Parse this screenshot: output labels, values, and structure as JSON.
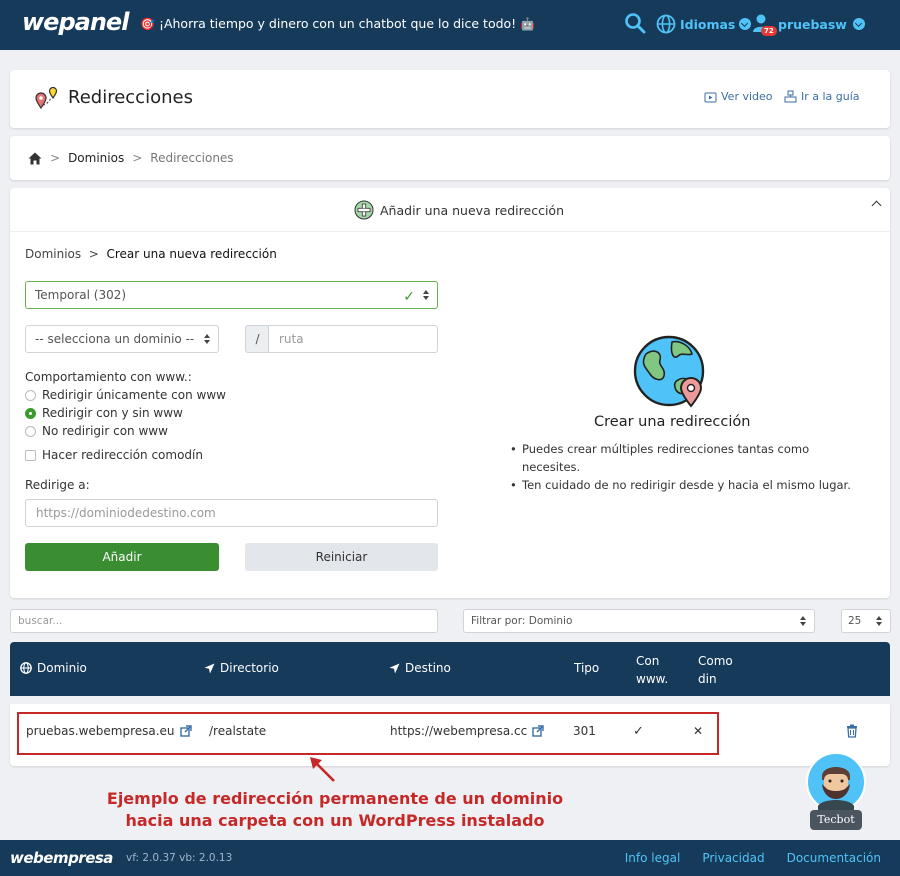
{
  "topbar": {
    "logo": "wepanel",
    "promo": "¡Ahorra tiempo y dinero con un chatbot que lo dice todo!",
    "lang_label": "Idiomas",
    "user_label": "pruebasw",
    "notifications": "72"
  },
  "header": {
    "title": "Redirecciones",
    "video_link": "Ver video",
    "guide_link": "Ir a la guía"
  },
  "breadcrumb": {
    "items": [
      "Dominios",
      "Redirecciones"
    ]
  },
  "form": {
    "toggle_label": "Añadir una nueva redirección",
    "path": [
      "Dominios",
      "Crear una nueva redirección"
    ],
    "type_value": "Temporal (302)",
    "domain_select": "-- selecciona un dominio --",
    "slash": "/",
    "route_placeholder": "ruta",
    "www_label": "Comportamiento con www.:",
    "www_options": [
      "Redirigir únicamente con www",
      "Redirigir con y sin www",
      "No redirigir con www"
    ],
    "www_selected": 1,
    "wildcard_label": "Hacer redirección comodín",
    "redirect_label": "Redirige a:",
    "dest_placeholder": "https://dominiodedestino.com",
    "add_button": "Añadir",
    "reset_button": "Reiniciar"
  },
  "info": {
    "title": "Crear una redirección",
    "bullets": [
      "Puedes crear múltiples redirecciones tantas como necesites.",
      "Ten cuidado de no redirigir desde y hacia el mismo lugar."
    ]
  },
  "filters": {
    "search_placeholder": "buscar...",
    "filter_value": "Filtrar por: Dominio",
    "per_page": "25"
  },
  "table": {
    "headers": [
      "Dominio",
      "Directorio",
      "Destino",
      "Tipo",
      "Con www.",
      "Como din"
    ],
    "rows": [
      {
        "domain": "pruebas.webempresa.eu",
        "directory": "/realstate",
        "destination": "https://webempresa.cc",
        "type": "301",
        "with_www": "✓",
        "wildcard": "✕"
      }
    ]
  },
  "annotation": {
    "line1": "Ejemplo de redirección permanente de un dominio",
    "line2": "hacia una carpeta con un WordPress instalado"
  },
  "chatbot": {
    "label": "Tecbot"
  },
  "footer": {
    "logo": "webempresa",
    "version": "vf: 2.0.37 vb: 2.0.13",
    "links": [
      "Info legal",
      "Privacidad",
      "Documentación"
    ]
  },
  "colors": {
    "navy": "#163a5a",
    "accent": "#4fc3f7",
    "green": "#3b8d32",
    "highlight": "#c62828"
  }
}
